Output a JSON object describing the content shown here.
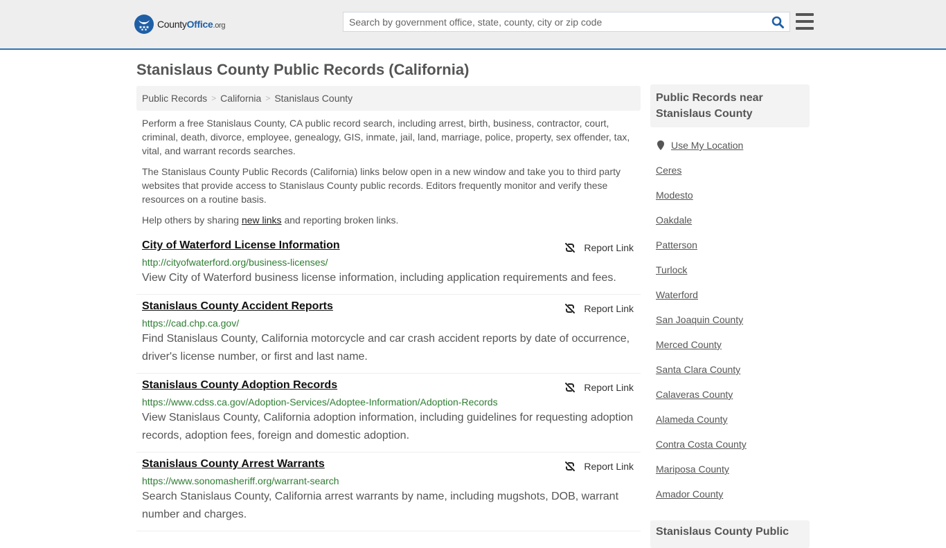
{
  "header": {
    "logo": {
      "brand_county": "County",
      "brand_office": "Office",
      "brand_tld": ".org",
      "icon": "eagle-stars-badge-icon"
    },
    "search": {
      "placeholder": "Search by government office, state, county, city or zip code",
      "value": "",
      "icon": "search-icon"
    },
    "menu_icon": "hamburger-menu-icon",
    "colors": {
      "accent": "#2f74b5",
      "brand_blue": "#1f5fa6",
      "header_bg": "#eeeeee"
    }
  },
  "page": {
    "title": "Stanislaus County Public Records (California)"
  },
  "breadcrumb": {
    "items": [
      "Public Records",
      "California",
      "Stanislaus County"
    ],
    "separator": ">"
  },
  "intro": {
    "p1": "Perform a free Stanislaus County, CA public record search, including arrest, birth, business, contractor, court, criminal, death, divorce, employee, genealogy, GIS, inmate, jail, land, marriage, police, property, sex offender, tax, vital, and warrant records searches.",
    "p2": "The Stanislaus County Public Records (California) links below open in a new window and take you to third party websites that provide access to Stanislaus County public records. Editors frequently monitor and verify these resources on a routine basis.",
    "p3_before": "Help others by sharing ",
    "p3_link": "new links",
    "p3_after": " and reporting broken links."
  },
  "records": [
    {
      "title": "City of Waterford License Information",
      "url": "http://cityofwaterford.org/business-licenses/",
      "description": "View City of Waterford business license information, including application requirements and fees.",
      "report_label": "Report Link"
    },
    {
      "title": "Stanislaus County Accident Reports",
      "url": "https://cad.chp.ca.gov/",
      "description": "Find Stanislaus County, California motorcycle and car crash accident reports by date of occurrence, driver's license number, or first and last name.",
      "report_label": "Report Link"
    },
    {
      "title": "Stanislaus County Adoption Records",
      "url": "https://www.cdss.ca.gov/Adoption-Services/Adoptee-Information/Adoption-Records",
      "description": "View Stanislaus County, California adoption information, including guidelines for requesting adoption records, adoption fees, foreign and domestic adoption.",
      "report_label": "Report Link"
    },
    {
      "title": "Stanislaus County Arrest Warrants",
      "url": "https://www.sonomasheriff.org/warrant-search",
      "description": "Search Stanislaus County, California arrest warrants by name, including mugshots, DOB, warrant number and charges.",
      "report_label": "Report Link"
    }
  ],
  "sidebar": {
    "heading": "Public Records near Stanislaus County",
    "use_location": "Use My Location",
    "items": [
      "Ceres",
      "Modesto",
      "Oakdale",
      "Patterson",
      "Turlock",
      "Waterford",
      "San Joaquin County",
      "Merced County",
      "Santa Clara County",
      "Calaveras County",
      "Alameda County",
      "Contra Costa County",
      "Mariposa County",
      "Amador County"
    ],
    "heading2": "Stanislaus County Public"
  }
}
